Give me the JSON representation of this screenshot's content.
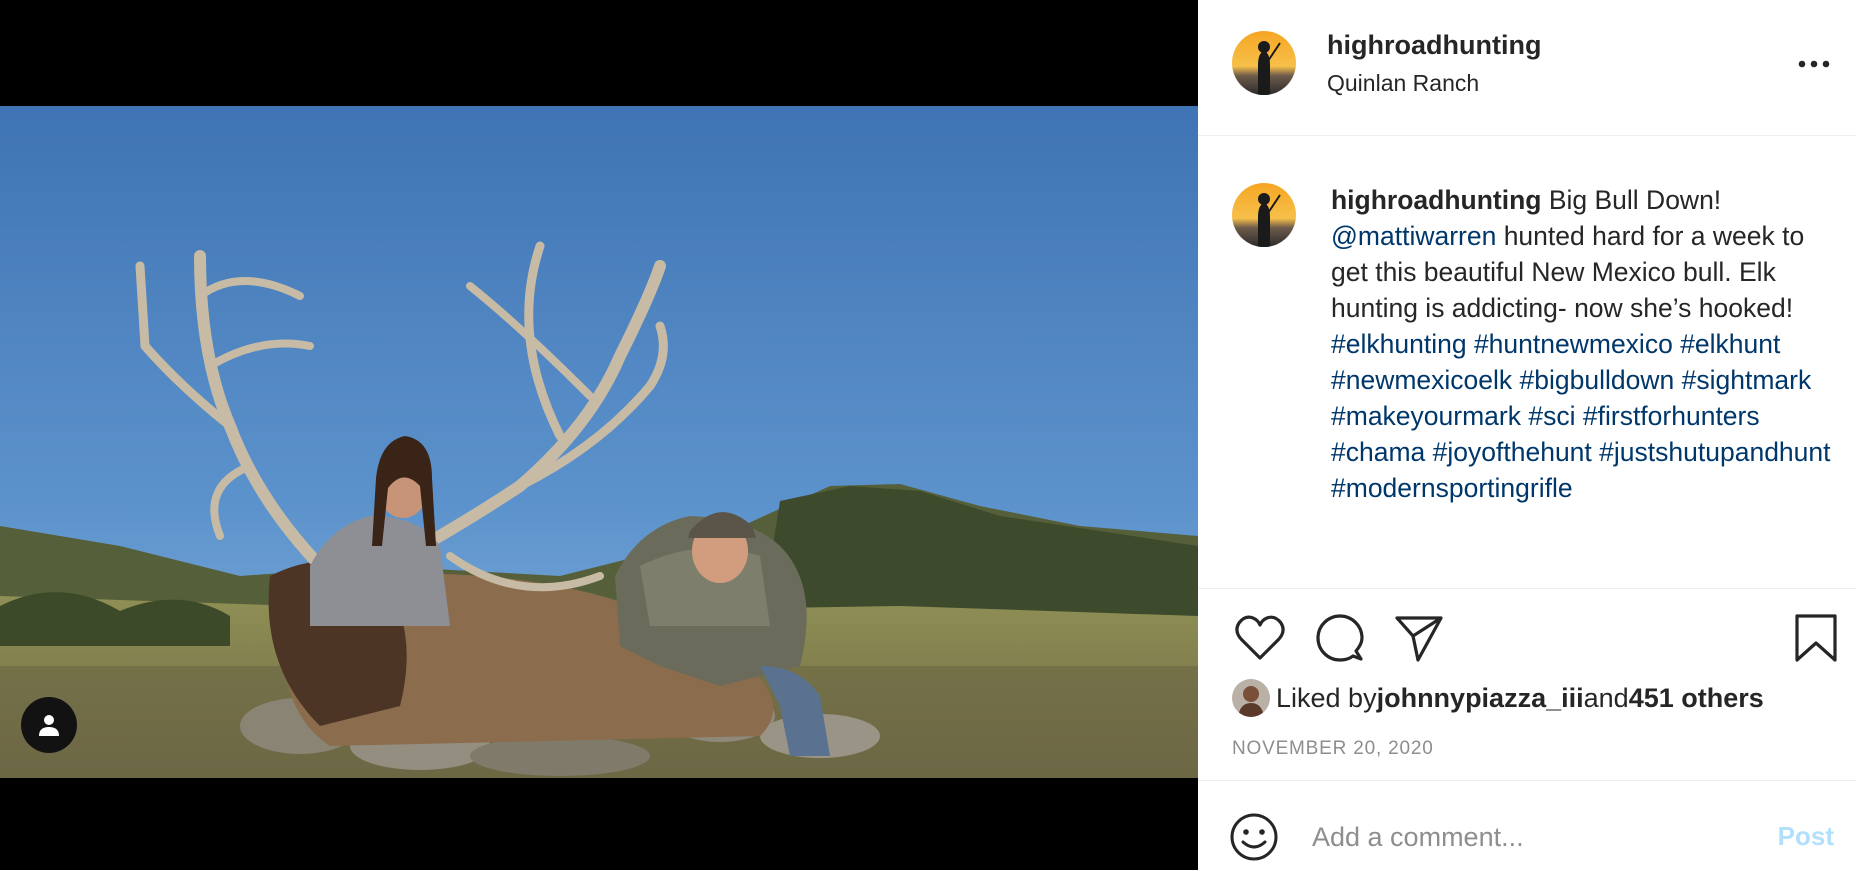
{
  "post": {
    "username": "highroadhunting",
    "location": "Quinlan Ranch",
    "caption": {
      "username": "highroadhunting",
      "text_1": " Big Bull Down! ",
      "mention": "@mattiwarren",
      "text_2": " hunted hard for a week to get this beautiful New Mexico bull. Elk hunting is addicting- now she’s hooked! ",
      "hashtags": [
        "#elkhunting",
        "#huntnewmexico",
        "#elkhunt",
        "#newmexicoelk",
        "#bigbulldown",
        "#sightmark",
        "#makeyourmark",
        "#sci",
        "#firstforhunters",
        "#chama",
        "#joyofthehunt",
        "#justshutupandhunt",
        "#modernsportingrifle"
      ]
    },
    "likes": {
      "prefix": "Liked by ",
      "liker": "johnnypiazza_iii",
      "middle": " and ",
      "others": "451 others"
    },
    "date": "NOVEMBER 20, 2020"
  },
  "comment": {
    "placeholder": "Add a comment...",
    "post_label": "Post"
  },
  "icons": {
    "more": "more-horizontal-icon",
    "like": "heart-icon",
    "comment": "comment-bubble-icon",
    "share": "paper-plane-icon",
    "save": "bookmark-icon",
    "emoji": "smiley-icon",
    "user_tag": "user-tag-icon"
  },
  "colors": {
    "link": "#00376b",
    "muted": "#8e8e8e",
    "post_disabled": "#b2dffc",
    "divider": "#efefef"
  }
}
